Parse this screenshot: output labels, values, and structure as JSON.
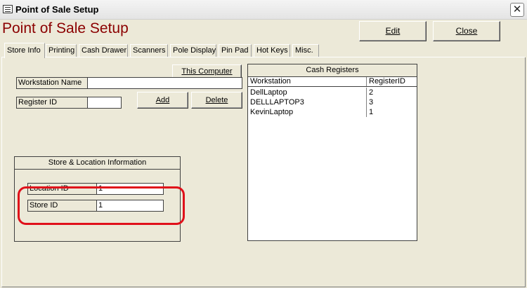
{
  "window": {
    "title": "Point of Sale Setup",
    "icon": "form-icon",
    "close_glyph": "✕"
  },
  "form": {
    "heading": "Point of Sale Setup",
    "heading_color": "#8b0000",
    "edit_label": "Edit",
    "close_label": "Close"
  },
  "tabs": [
    {
      "label": "Store Info",
      "active": true
    },
    {
      "label": "Printing"
    },
    {
      "label": "Cash Drawer"
    },
    {
      "label": "Scanners"
    },
    {
      "label": "Pole Display"
    },
    {
      "label": "Pin Pad"
    },
    {
      "label": "Hot Keys"
    },
    {
      "label": "Misc."
    }
  ],
  "store_info": {
    "this_computer_label": "This Computer",
    "workstation_name_label": "Workstation Name",
    "workstation_name_value": "",
    "register_id_label": "Register ID",
    "register_id_value": "",
    "add_label": "Add",
    "delete_label": "Delete"
  },
  "cash_registers": {
    "title": "Cash Registers",
    "columns": [
      "Workstation",
      "RegisterID"
    ],
    "rows": [
      {
        "workstation": "DellLaptop",
        "register_id": "2"
      },
      {
        "workstation": "DELLLAPTOP3",
        "register_id": "3"
      },
      {
        "workstation": "KevinLaptop",
        "register_id": "1"
      }
    ]
  },
  "store_location": {
    "title": "Store & Location Information",
    "location_id_label": "Location ID",
    "location_id_value": "1",
    "store_id_label": "Store ID",
    "store_id_value": "1"
  },
  "annotation": {
    "highlight_color": "#e0101a"
  }
}
